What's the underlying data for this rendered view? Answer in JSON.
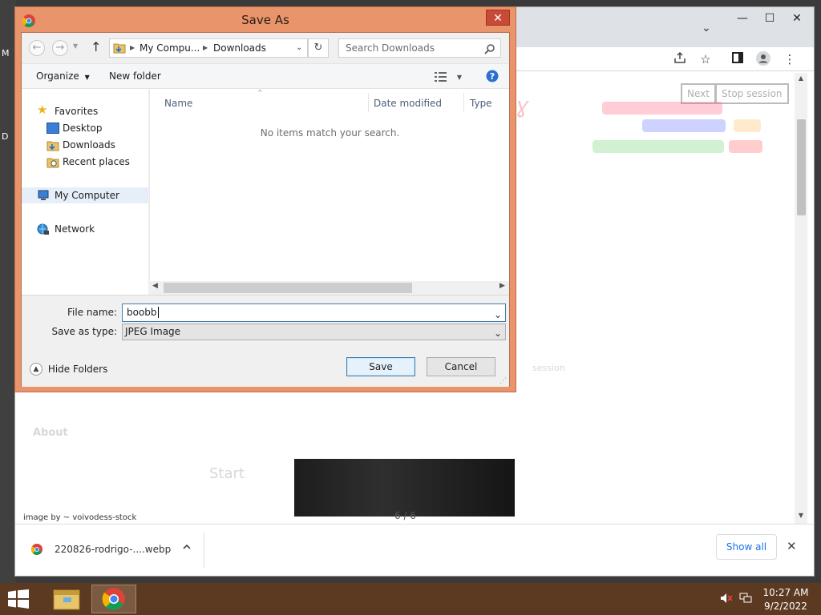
{
  "desktop": {
    "edge_labels": [
      "M",
      "D"
    ]
  },
  "browser": {
    "window_controls": {
      "minimize": "—",
      "maximize": "☐",
      "close": "✕"
    },
    "tab_dropdown": "⌄",
    "page_buttons": {
      "next": "Next",
      "stop": "Stop session"
    },
    "photo_credit": "image by ~ voivodess-stock",
    "counter": "6 / 6",
    "faint_text": {
      "about": "About",
      "start": "Start",
      "session": "session"
    },
    "download": {
      "filename": "220826-rodrigo-....webp",
      "show_all": "Show all",
      "close": "✕"
    }
  },
  "dialog": {
    "title": "Save As",
    "close": "✕",
    "breadcrumb": [
      "My Compu...",
      "Downloads"
    ],
    "search_placeholder": "Search Downloads",
    "toolbar": {
      "organize": "Organize",
      "new_folder": "New folder"
    },
    "nav": {
      "favorites": "Favorites",
      "desktop": "Desktop",
      "downloads": "Downloads",
      "recent": "Recent places",
      "computer": "My Computer",
      "network": "Network"
    },
    "columns": {
      "name": "Name",
      "date": "Date modified",
      "type": "Type"
    },
    "empty_message": "No items match your search.",
    "form": {
      "file_name_label": "File name:",
      "file_name_value": "boobb",
      "save_type_label": "Save as type:",
      "save_type_value": "JPEG Image"
    },
    "hide_folders": "Hide Folders",
    "save": "Save",
    "cancel": "Cancel"
  },
  "taskbar": {
    "time": "10:27 AM",
    "date": "9/2/2022"
  },
  "colors": {
    "dialog_frame": "#e9946b",
    "close_red": "#c74b36",
    "taskbar": "#5c3a22",
    "accent_blue": "#1a73e8"
  }
}
